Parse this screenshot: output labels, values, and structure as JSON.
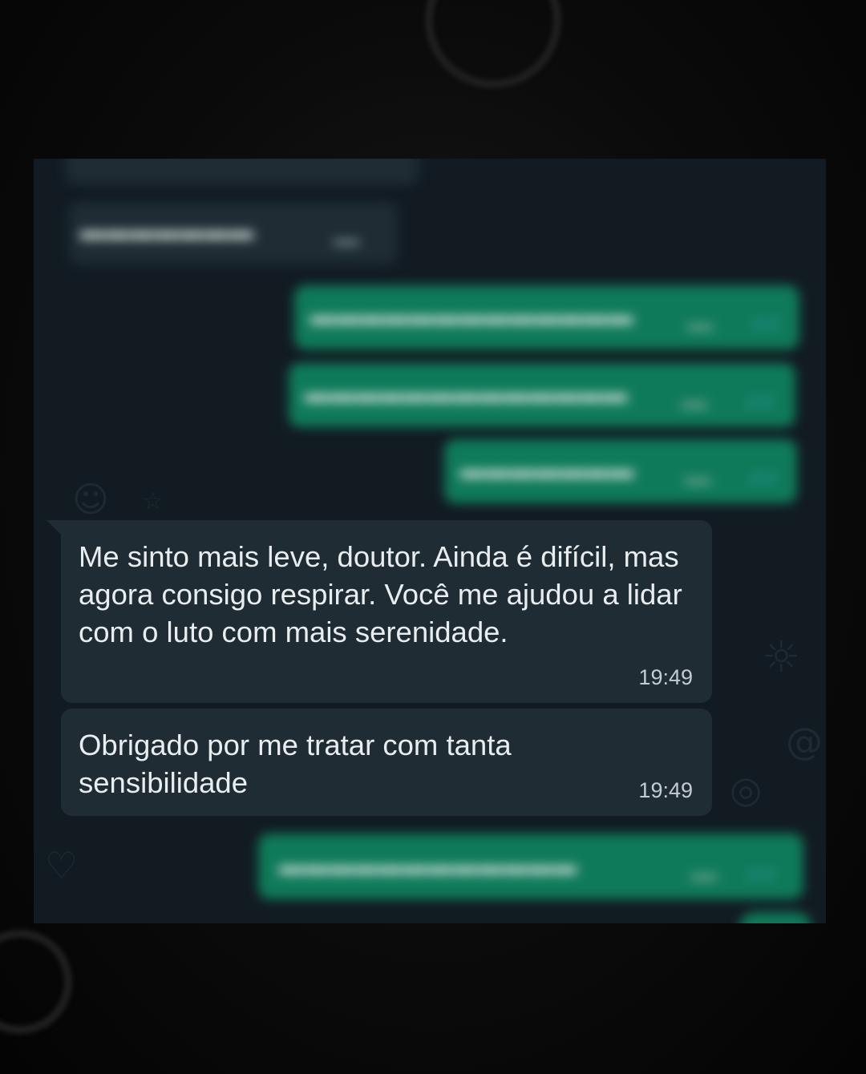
{
  "messages": [
    {
      "direction": "incoming",
      "text": "Me sinto mais leve, doutor. Ainda é difícil, mas agora consigo respirar. Você me ajudou a lidar com o luto com mais serenidade.",
      "time": "19:49"
    },
    {
      "direction": "incoming",
      "text": "Obrigado por me tratar com tanta sensibilidade",
      "time": "19:49"
    }
  ],
  "colors": {
    "chat_background": "#121b22",
    "incoming_bubble": "#1f2c34",
    "outgoing_bubble": "#0f7a5a",
    "read_check": "#53bdeb"
  }
}
